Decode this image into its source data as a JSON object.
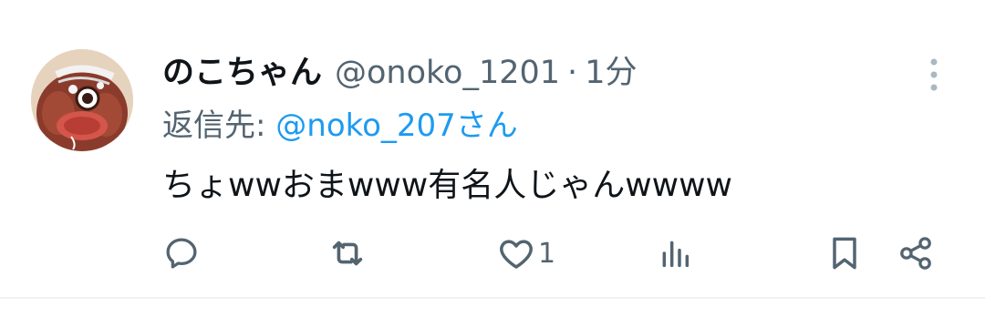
{
  "tweet": {
    "display_name": "のこちゃん",
    "handle": "@onoko_1201",
    "separator": "·",
    "time": "1分",
    "reply_prefix": "返信先: ",
    "reply_to": "@noko_207さん",
    "text": "ちょwwおまwww有名人じゃんwwww"
  },
  "actions": {
    "reply_icon": "reply-icon",
    "retweet_icon": "retweet-icon",
    "like_icon": "heart-icon",
    "like_count": "1",
    "views_icon": "bar-chart-icon",
    "bookmark_icon": "bookmark-icon",
    "share_icon": "share-icon"
  },
  "colors": {
    "text": "#0f1419",
    "secondary": "#536471",
    "link": "#1d9bf0",
    "divider": "#eff3f4"
  }
}
